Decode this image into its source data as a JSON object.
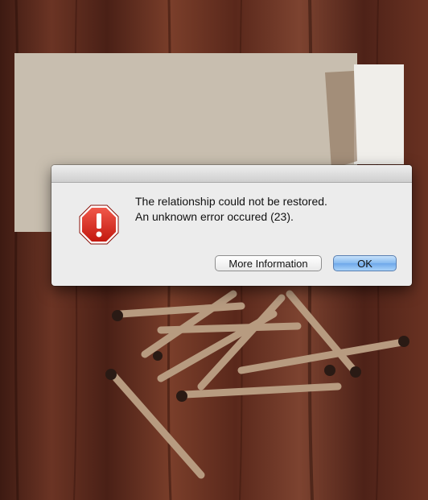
{
  "dialog": {
    "icon": "stop-exclamation-icon",
    "message_line1": "The relationship could not be restored.",
    "message_line2": "An unknown error occured (23).",
    "buttons": {
      "more_info_label": "More Information",
      "ok_label": "OK"
    }
  },
  "colors": {
    "icon_red": "#e0281b",
    "ok_button_blue": "#84b9ef",
    "dialog_bg": "#ececec"
  }
}
